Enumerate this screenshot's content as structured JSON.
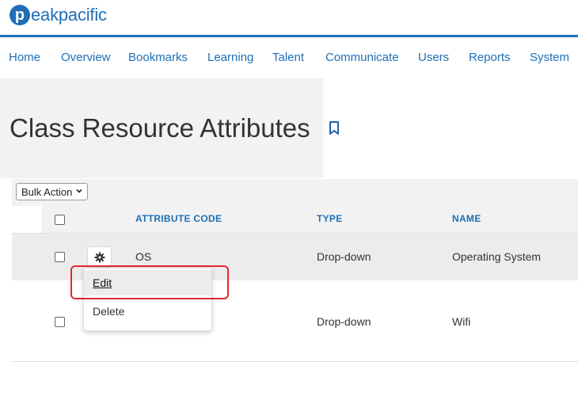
{
  "brand": {
    "logo_letter": "p",
    "logo_text": "eakpacific",
    "accent": "#1f6fb6"
  },
  "nav": [
    "Home",
    "Overview",
    "Bookmarks",
    "Learning",
    "Talent",
    "Communicate",
    "Users",
    "Reports",
    "System"
  ],
  "page": {
    "title": "Class Resource Attributes",
    "bookmark_icon": "bookmark-icon"
  },
  "bulk_action": {
    "selected": "Bulk Action"
  },
  "table": {
    "columns": [
      "ATTRIBUTE CODE",
      "TYPE",
      "NAME"
    ],
    "rows": [
      {
        "code": "OS",
        "type": "Drop-down",
        "name": "Operating System"
      },
      {
        "code": "",
        "type": "Drop-down",
        "name": "Wifi"
      }
    ]
  },
  "row_menu": {
    "items": [
      "Edit",
      "Delete"
    ],
    "active": "Edit"
  },
  "highlight_color": "#e0282f"
}
